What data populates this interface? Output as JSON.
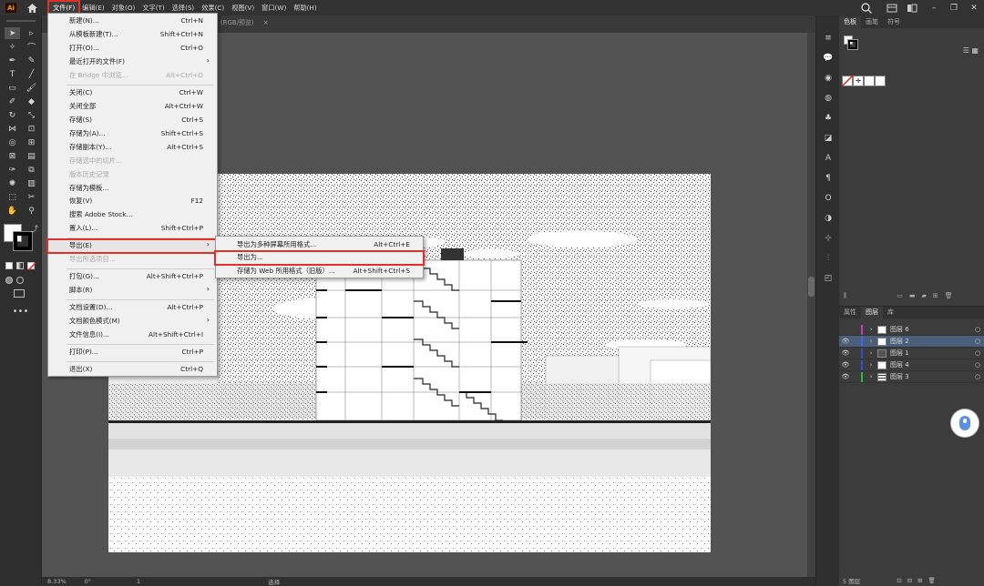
{
  "app": {
    "logo": "Ai"
  },
  "menubar": {
    "items": [
      "文件(F)",
      "编辑(E)",
      "对象(O)",
      "文字(T)",
      "选择(S)",
      "效果(C)",
      "视图(V)",
      "窗口(W)",
      "帮助(H)"
    ]
  },
  "tab": {
    "label": "s (RGB/预览)",
    "close": "×"
  },
  "file_menu": {
    "items": [
      {
        "label": "新建(N)...",
        "shortcut": "Ctrl+N"
      },
      {
        "label": "从模板新建(T)...",
        "shortcut": "Shift+Ctrl+N"
      },
      {
        "label": "打开(O)...",
        "shortcut": "Ctrl+O"
      },
      {
        "label": "最近打开的文件(F)",
        "shortcut": ""
      },
      {
        "label": "在 Bridge 中浏览...",
        "shortcut": "Alt+Ctrl+O"
      },
      {
        "label": "关闭(C)",
        "shortcut": "Ctrl+W"
      },
      {
        "label": "关闭全部",
        "shortcut": "Alt+Ctrl+W"
      },
      {
        "label": "存储(S)",
        "shortcut": "Ctrl+S"
      },
      {
        "label": "存储为(A)...",
        "shortcut": "Shift+Ctrl+S"
      },
      {
        "label": "存储副本(Y)...",
        "shortcut": "Alt+Ctrl+S"
      },
      {
        "label": "存储选中的切片...",
        "shortcut": ""
      },
      {
        "label": "版本历史记录",
        "shortcut": ""
      },
      {
        "label": "存储为模板...",
        "shortcut": ""
      },
      {
        "label": "恢复(V)",
        "shortcut": "F12"
      },
      {
        "label": "搜索 Adobe Stock...",
        "shortcut": ""
      },
      {
        "label": "置入(L)...",
        "shortcut": "Shift+Ctrl+P"
      },
      {
        "label": "导出(E)",
        "shortcut": ""
      },
      {
        "label": "导出所选项目...",
        "shortcut": ""
      },
      {
        "label": "打包(G)...",
        "shortcut": "Alt+Shift+Ctrl+P"
      },
      {
        "label": "脚本(R)",
        "shortcut": ""
      },
      {
        "label": "文档设置(D)...",
        "shortcut": "Alt+Ctrl+P"
      },
      {
        "label": "文档颜色模式(M)",
        "shortcut": ""
      },
      {
        "label": "文件信息(I)...",
        "shortcut": "Alt+Shift+Ctrl+I"
      },
      {
        "label": "打印(P)...",
        "shortcut": "Ctrl+P"
      },
      {
        "label": "退出(X)",
        "shortcut": "Ctrl+Q"
      }
    ]
  },
  "export_submenu": {
    "items": [
      {
        "label": "导出为多种屏幕所用格式...",
        "shortcut": "Alt+Ctrl+E"
      },
      {
        "label": "导出为...",
        "shortcut": ""
      },
      {
        "label": "存储为 Web 所用格式（旧版）...",
        "shortcut": "Alt+Shift+Ctrl+S"
      }
    ]
  },
  "swatches_panel": {
    "tabs": [
      "色板",
      "画笔",
      "符号"
    ]
  },
  "layers_panel": {
    "tabs": [
      "属性",
      "图层",
      "库"
    ],
    "layers": [
      {
        "name": "图层 6",
        "color": "#c040c0",
        "selected": false
      },
      {
        "name": "图层 2",
        "color": "#4060ff",
        "selected": true
      },
      {
        "name": "图层 1",
        "color": "#3050d0",
        "selected": false
      },
      {
        "name": "图层 4",
        "color": "#3050d0",
        "selected": false
      },
      {
        "name": "图层 3",
        "color": "#20c040",
        "selected": false
      }
    ],
    "footer": "5 图层"
  },
  "statusbar": {
    "zoom": "8.33%",
    "angle": "0°",
    "page": "1",
    "tool": "选择"
  }
}
